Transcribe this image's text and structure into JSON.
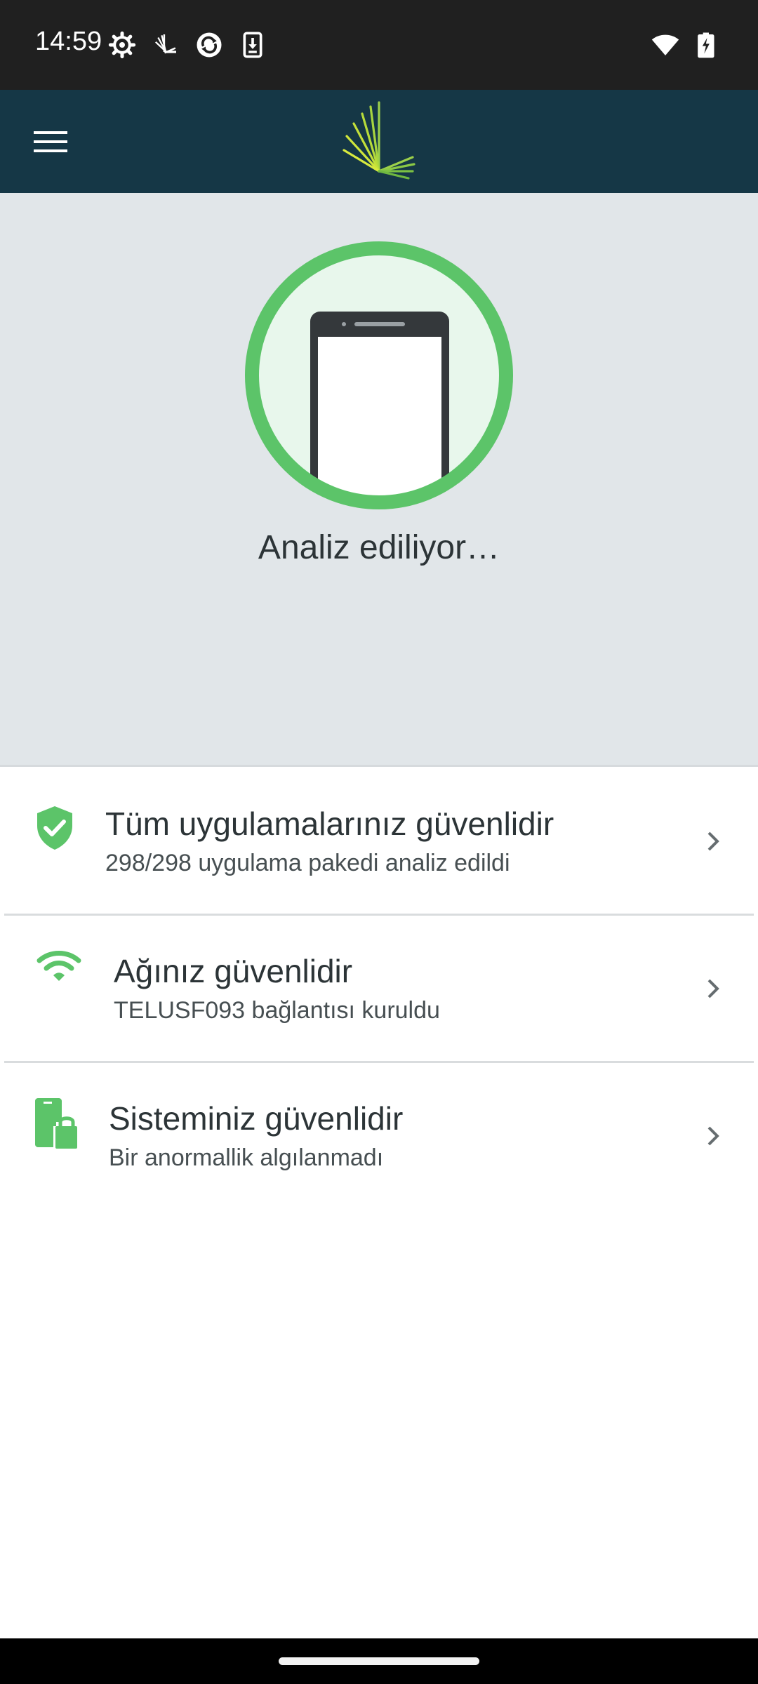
{
  "status_bar": {
    "time": "14:59",
    "left_icons": [
      "settings-icon",
      "app-notification-icon",
      "sync-icon",
      "download-icon"
    ],
    "right_icons": [
      "wifi-icon",
      "battery-charging-icon"
    ]
  },
  "app_bar": {
    "menu_icon": "hamburger-menu-icon",
    "logo": "telus-logo"
  },
  "hero": {
    "status_text": "Analiz ediliyor…",
    "ring_color": "#5cc469",
    "ring_fill": "#e8f7ec"
  },
  "items": [
    {
      "icon": "shield-check-icon",
      "title": "Tüm uygulamalarınız güvenlidir",
      "subtitle": "298/298 uygulama pakedi analiz edildi"
    },
    {
      "icon": "wifi-icon",
      "title": "Ağınız güvenlidir",
      "subtitle": "TELUSF093 bağlantısı kuruldu"
    },
    {
      "icon": "phone-lock-icon",
      "title": "Sisteminiz güvenlidir",
      "subtitle": "Bir anormallik algılanmadı"
    }
  ],
  "colors": {
    "accent_green": "#5cc469",
    "app_bar": "#153746",
    "hero_bg": "#e1e6e9"
  }
}
